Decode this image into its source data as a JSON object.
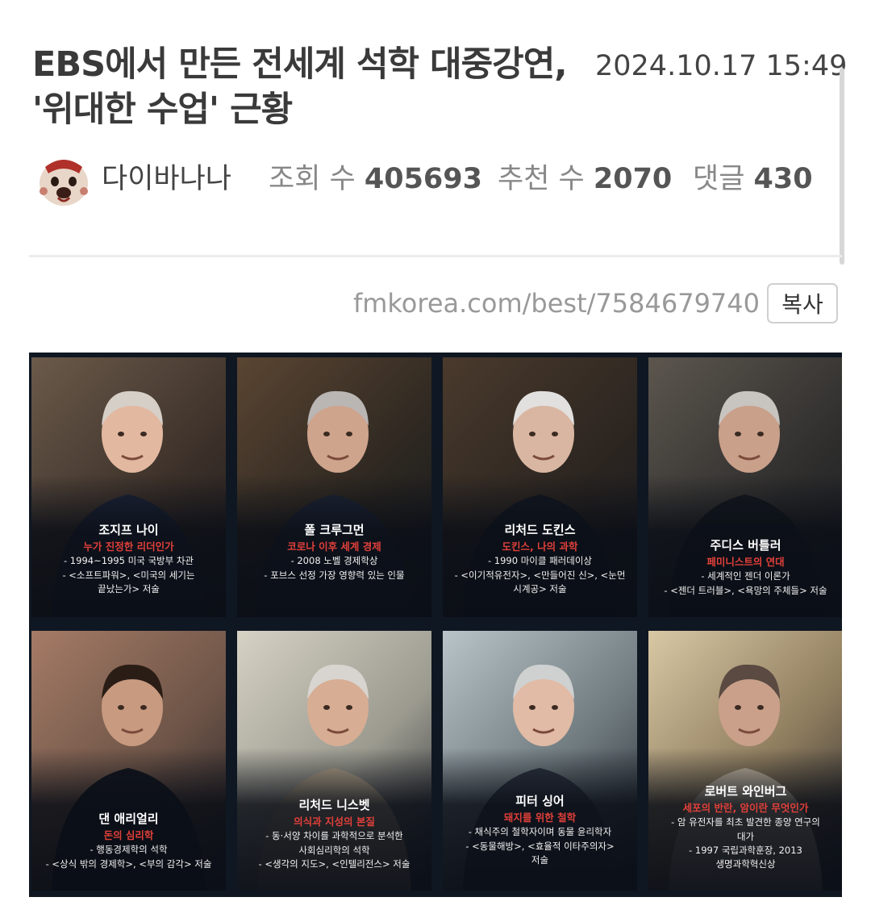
{
  "post": {
    "title": "EBS에서 만든 전세계 석학 대중강연, '위대한 수업' 근황",
    "date": "2024.10.17 15:49",
    "author": "다이바나나",
    "views_label": "조회 수",
    "views": "405693",
    "recommend_label": "추천 수",
    "recommend": "2070",
    "comments_label": "댓글",
    "comments": "430",
    "url": "fmkorea.com/best/7584679740",
    "copy_label": "복사"
  },
  "people": [
    {
      "name": "조지프 나이",
      "subtitle": "누가 진정한 리더인가",
      "lines": [
        "- 1994~1995 미국 국방부 차관",
        "- <소프트파워>, <미국의 세기는",
        "끝났는가> 저술"
      ]
    },
    {
      "name": "폴 크루그먼",
      "subtitle": "코로나 이후 세계 경제",
      "lines": [
        "- 2008 노벨 경제학상",
        "- 포브스 선정 가장 영향력 있는 인물"
      ]
    },
    {
      "name": "리처드 도킨스",
      "subtitle": "도킨스, 나의 과학",
      "lines": [
        "- 1990 마이클 패러데이상",
        "- <이기적유전자>, <만들어진 신>, <눈먼",
        "시계공> 저술"
      ]
    },
    {
      "name": "주디스 버틀러",
      "subtitle": "페미니스트의 연대",
      "lines": [
        "- 세계적인 젠더 이론가",
        "- <젠더 트러블>, <욕망의 주체들> 저술"
      ]
    },
    {
      "name": "댄 애리얼리",
      "subtitle": "돈의 심리학",
      "lines": [
        "- 행동경제학의 석학",
        "- <상식 밖의 경제학>, <부의 감각> 저술"
      ]
    },
    {
      "name": "리처드 니스벳",
      "subtitle": "의식과 지성의 본질",
      "lines": [
        "- 동·서양 차이를 과학적으로 분석한",
        "사회심리학의 석학",
        "- <생각의 지도>, <인텔리전스> 저술"
      ]
    },
    {
      "name": "피터 싱어",
      "subtitle": "돼지를 위한 철학",
      "lines": [
        "- 채식주의 철학자이며 동물 윤리학자",
        "- <동물해방>, <효율적 이타주의자>",
        "저술"
      ]
    },
    {
      "name": "로버트 와인버그",
      "subtitle": "세포의 반란, 암이란 무엇인가",
      "lines": [
        "- 암 유전자를 최초 발견한 종양 연구의",
        "대가",
        "- 1997 국립과학훈장, 2013",
        "생명과학혁신상"
      ]
    }
  ],
  "colors": {
    "title": "#3a3a3a",
    "accent_red": "#e0403a",
    "poster_bg": "#0f1722"
  }
}
